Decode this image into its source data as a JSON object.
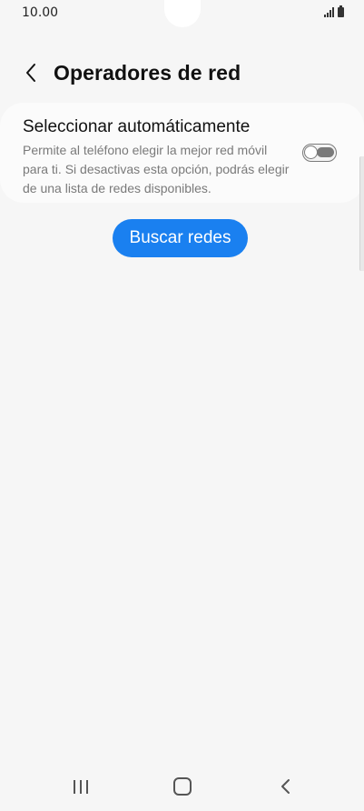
{
  "status_bar": {
    "time": "10.00"
  },
  "header": {
    "title": "Operadores de red"
  },
  "auto_select": {
    "title": "Seleccionar automáticamente",
    "description": "Permite al teléfono elegir la mejor red móvil para ti. Si desactivas esta opción, podrás elegir de una lista de redes disponibles.",
    "toggle_on": false
  },
  "search_button": {
    "label": "Buscar redes"
  },
  "colors": {
    "accent": "#1a80f0",
    "background": "#f6f6f6",
    "card": "#fbfbfb",
    "secondary_text": "#7a7a7a"
  },
  "icons": {
    "back": "chevron-left-icon",
    "nav_recent": "recent-apps-icon",
    "nav_home": "home-icon",
    "nav_back": "back-icon"
  }
}
